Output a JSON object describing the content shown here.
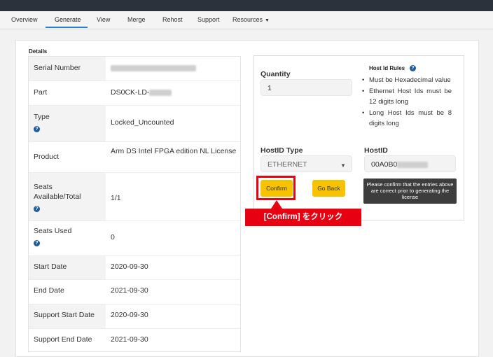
{
  "nav": {
    "items": [
      {
        "label": "Overview"
      },
      {
        "label": "Generate"
      },
      {
        "label": "View"
      },
      {
        "label": "Merge"
      },
      {
        "label": "Rehost"
      },
      {
        "label": "Support"
      },
      {
        "label": "Resources"
      }
    ],
    "active": "Generate"
  },
  "details": {
    "heading": "Details",
    "rows": [
      {
        "label": "Serial Number",
        "value": ""
      },
      {
        "label": "Part",
        "value": "DS0CK-LD-"
      },
      {
        "label": "Type",
        "value": "Locked_Uncounted"
      },
      {
        "label": "Product",
        "value": "Arm DS Intel FPGA edition NL License"
      },
      {
        "label": "Seats Available/Total",
        "value": "1/1"
      },
      {
        "label": "Seats Used",
        "value": "0"
      },
      {
        "label": "Start Date",
        "value": "2020-09-30"
      },
      {
        "label": "End Date",
        "value": "2021-09-30"
      },
      {
        "label": "Support Start Date",
        "value": "2020-09-30"
      },
      {
        "label": "Support End Date",
        "value": "2021-09-30"
      }
    ]
  },
  "form": {
    "quantity_label": "Quantity",
    "quantity_value": "1",
    "hostid_type_label": "HostID Type",
    "hostid_type_value": "ETHERNET",
    "hostid_label": "HostID",
    "hostid_value": "00A0B0",
    "confirm_label": "Confirm",
    "goback_label": "Go Back",
    "tooltip": "Please confirm that the entries above are correct prior to generating the license"
  },
  "rules": {
    "title": "Host Id Rules",
    "items": [
      "Must be Hexadecimal value",
      "Ethernet Host Ids must be 12 digits long",
      "Long Host Ids must be 8 digits long"
    ]
  },
  "annotation": {
    "callout": "[Confirm] をクリック"
  },
  "colors": {
    "accent_yellow": "#f7c200",
    "highlight_red": "#e60012",
    "nav_underline": "#2b7fd1",
    "topbar": "#2c323b"
  },
  "icons": {
    "help": "help-circle-icon",
    "dropdown": "chevron-down-icon"
  }
}
